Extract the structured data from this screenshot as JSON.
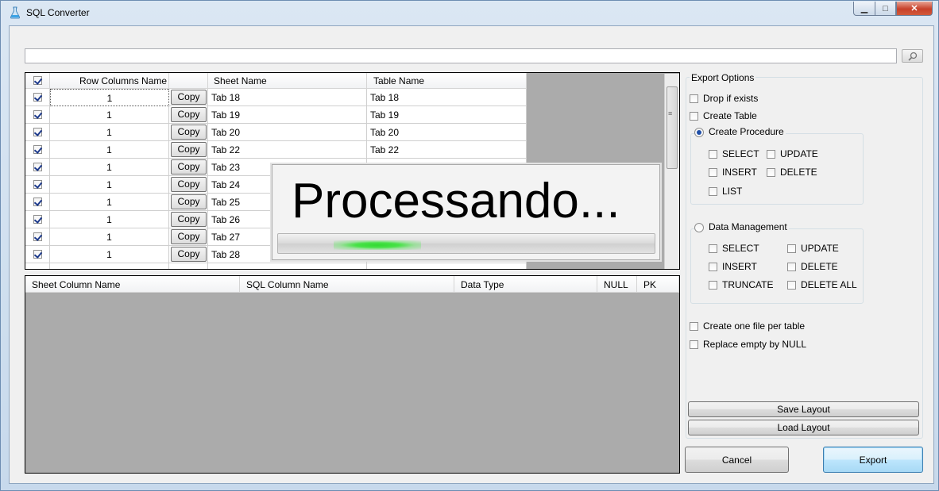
{
  "window": {
    "title": "SQL Converter"
  },
  "search": {
    "value": "",
    "placeholder": ""
  },
  "top_grid": {
    "headers": [
      "Row Columns Name",
      "",
      "Sheet Name",
      "Table Name"
    ],
    "select_all_checked": true,
    "rows": [
      {
        "checked": true,
        "row": "1",
        "copy": "Copy",
        "sheet": "Tab 18",
        "table": "Tab 18"
      },
      {
        "checked": true,
        "row": "1",
        "copy": "Copy",
        "sheet": "Tab 19",
        "table": "Tab 19"
      },
      {
        "checked": true,
        "row": "1",
        "copy": "Copy",
        "sheet": "Tab 20",
        "table": "Tab 20"
      },
      {
        "checked": true,
        "row": "1",
        "copy": "Copy",
        "sheet": "Tab 22",
        "table": "Tab 22"
      },
      {
        "checked": true,
        "row": "1",
        "copy": "Copy",
        "sheet": "Tab 23",
        "table": ""
      },
      {
        "checked": true,
        "row": "1",
        "copy": "Copy",
        "sheet": "Tab 24",
        "table": ""
      },
      {
        "checked": true,
        "row": "1",
        "copy": "Copy",
        "sheet": "Tab 25",
        "table": ""
      },
      {
        "checked": true,
        "row": "1",
        "copy": "Copy",
        "sheet": "Tab 26",
        "table": ""
      },
      {
        "checked": true,
        "row": "1",
        "copy": "Copy",
        "sheet": "Tab 27",
        "table": ""
      },
      {
        "checked": true,
        "row": "1",
        "copy": "Copy",
        "sheet": "Tab 28",
        "table": ""
      }
    ]
  },
  "bottom_grid": {
    "headers": [
      "Sheet Column Name",
      "SQL Column Name",
      "Data Type",
      "NULL",
      "PK"
    ]
  },
  "overlay": {
    "text": "Processando...",
    "progress_indeterminate": true
  },
  "export_options": {
    "title": "Export Options",
    "drop_if_exists": {
      "label": "Drop if exists",
      "checked": false
    },
    "create_table": {
      "label": "Create Table",
      "checked": false
    },
    "create_procedure": {
      "label": "Create Procedure",
      "selected": true,
      "items": [
        {
          "label": "SELECT",
          "checked": false
        },
        {
          "label": "UPDATE",
          "checked": false
        },
        {
          "label": "INSERT",
          "checked": false
        },
        {
          "label": "DELETE",
          "checked": false
        },
        {
          "label": "LIST",
          "checked": false
        }
      ]
    },
    "data_management": {
      "label": "Data Management",
      "selected": false,
      "items": [
        {
          "label": "SELECT",
          "checked": false
        },
        {
          "label": "UPDATE",
          "checked": false
        },
        {
          "label": "INSERT",
          "checked": false
        },
        {
          "label": "DELETE",
          "checked": false
        },
        {
          "label": "TRUNCATE",
          "checked": false
        },
        {
          "label": "DELETE ALL",
          "checked": false
        }
      ]
    },
    "one_file_per_table": {
      "label": "Create one file per table",
      "checked": false
    },
    "replace_empty_null": {
      "label": "Replace empty by NULL",
      "checked": false
    }
  },
  "buttons": {
    "save_layout": "Save Layout",
    "load_layout": "Load Layout",
    "cancel": "Cancel",
    "export": "Export"
  },
  "icons": {
    "app": "sql-flask-icon",
    "search": "magnifier-icon",
    "minimize": "minimize-icon",
    "maximize": "maximize-icon",
    "close": "close-icon"
  }
}
